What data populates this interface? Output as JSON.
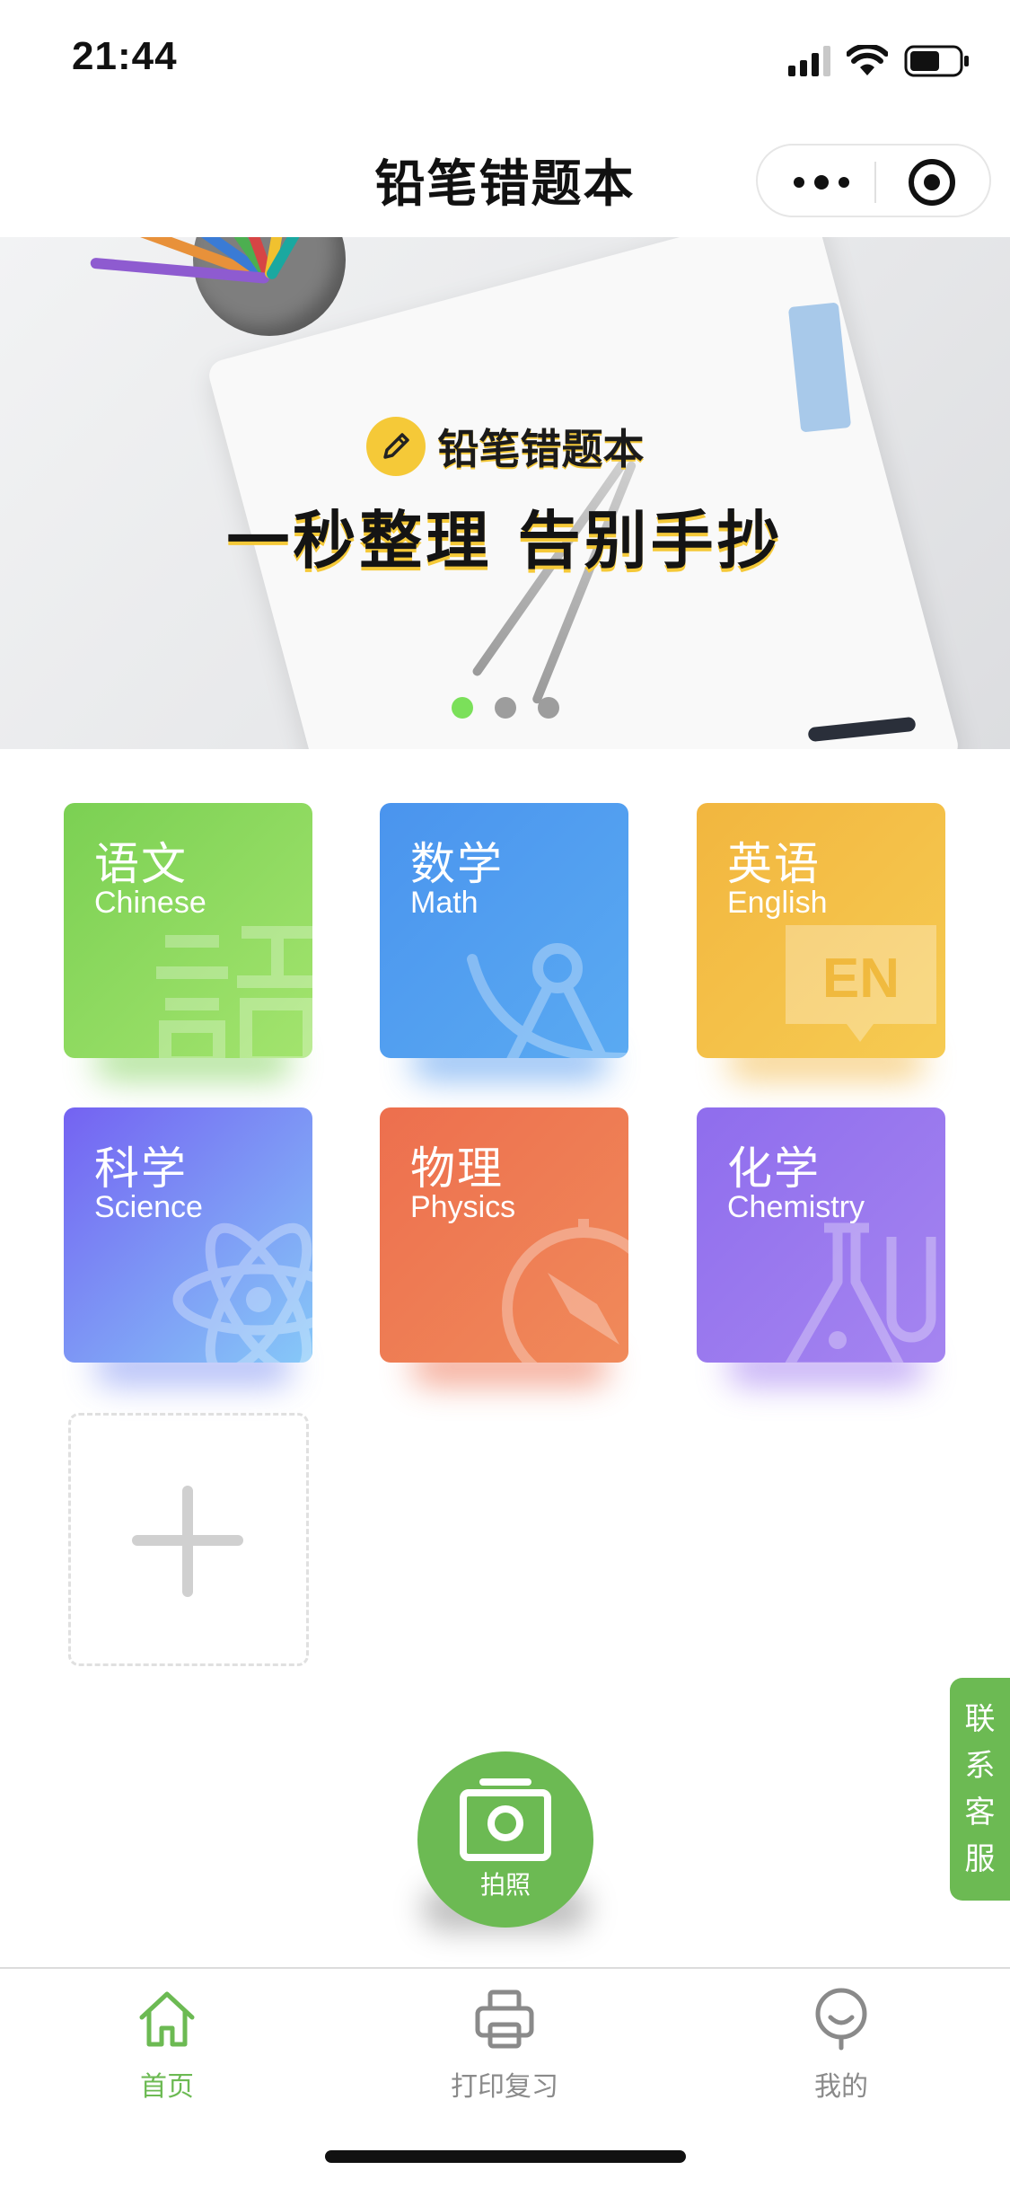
{
  "status_bar": {
    "time": "21:44",
    "icons": [
      "cellular-signal-icon",
      "wifi-icon",
      "battery-icon"
    ]
  },
  "nav": {
    "title": "铅笔错题本",
    "capsule_icons": [
      "more-dots-icon",
      "close-target-icon"
    ]
  },
  "banner": {
    "brand": "铅笔错题本",
    "slogan": "一秒整理 告别手抄",
    "active_slide": 1,
    "slide_count": 3
  },
  "subjects": [
    {
      "cn": "语文",
      "en": "Chinese",
      "color_from": "#7bd053",
      "color_to": "#a3e46e",
      "icon": "chinese-character-icon"
    },
    {
      "cn": "数学",
      "en": "Math",
      "color_from": "#4a94ee",
      "color_to": "#5aaaf2",
      "icon": "compass-tool-icon"
    },
    {
      "cn": "英语",
      "en": "English",
      "color_from": "#f2b63f",
      "color_to": "#f6cb52",
      "icon": "en-speech-bubble-icon"
    },
    {
      "cn": "科学",
      "en": "Science",
      "color_from": "#7462f2",
      "color_to": "#86c9f8",
      "icon": "atom-icon"
    },
    {
      "cn": "物理",
      "en": "Physics",
      "color_from": "#ed6f4e",
      "color_to": "#f08a5a",
      "icon": "navigation-compass-icon"
    },
    {
      "cn": "化学",
      "en": "Chemistry",
      "color_from": "#8f6ded",
      "color_to": "#a585f0",
      "icon": "flask-icon"
    }
  ],
  "add_subject": {
    "icon": "plus-icon"
  },
  "contact": {
    "label_chars": [
      "联",
      "系",
      "客",
      "服"
    ]
  },
  "camera_button": {
    "label": "拍照",
    "icon": "camera-icon"
  },
  "tabs": [
    {
      "label": "首页",
      "icon": "home-icon",
      "active": true
    },
    {
      "label": "打印复习",
      "icon": "printer-icon",
      "active": false
    },
    {
      "label": "我的",
      "icon": "profile-icon",
      "active": false
    }
  ],
  "colors": {
    "accent_green": "#6cba53",
    "tab_active": "#6cba53",
    "tab_inactive": "#8a8a8a",
    "banner_highlight": "#f5c938"
  }
}
